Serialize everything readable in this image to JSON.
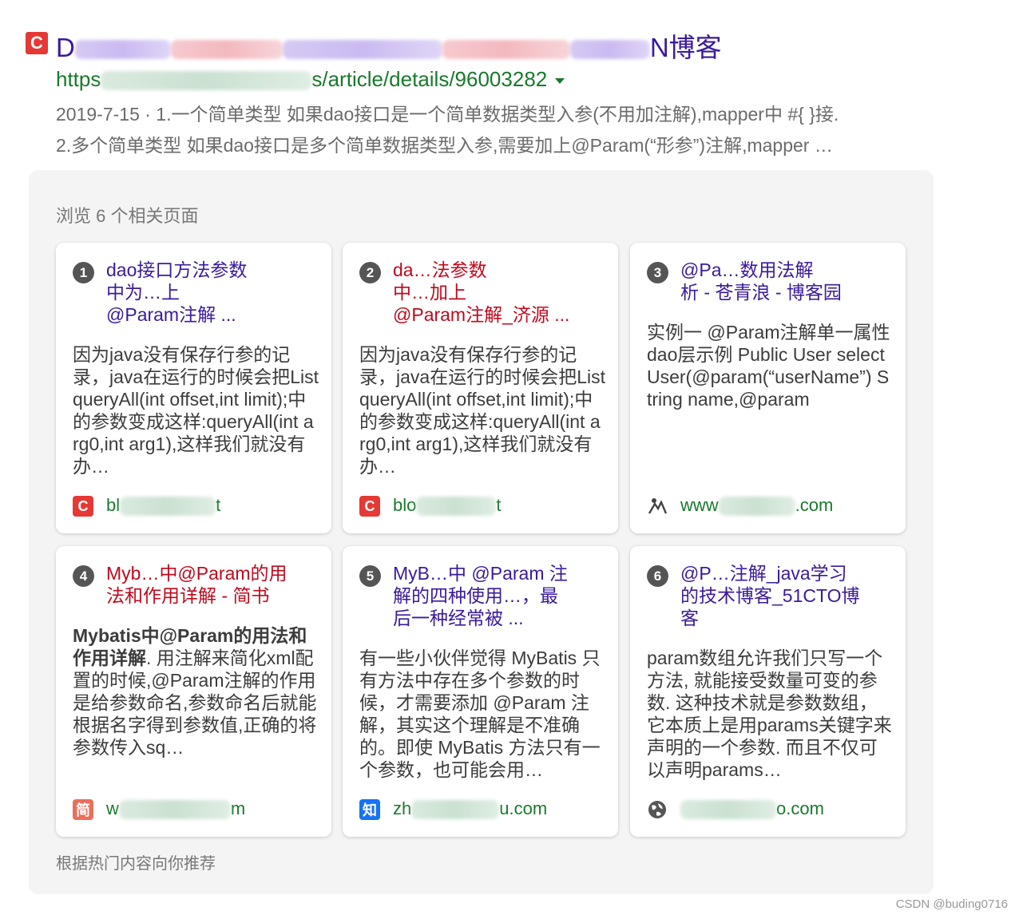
{
  "result": {
    "logo_letter": "C",
    "title_start": "D",
    "title_end": "N博客",
    "url_start": "https",
    "url_end": "s/article/details/96003282",
    "snippet_line1": "2019-7-15 · 1.一个简单类型 如果dao接口是一个简单数据类型入参(不用加注解),mapper中 #{ }接.",
    "snippet_line2": "2.多个简单类型 如果dao接口是多个简单数据类型入参,需要加上@Param(“形参”)注解,mapper …"
  },
  "panel": {
    "heading": "浏览 6 个相关页面",
    "footer": "根据热门内容向你推荐"
  },
  "cards": [
    {
      "number": "1",
      "title_line1": "dao接口方法参数",
      "title_line2": "中为…上",
      "title_line3": "@Param注解 ...",
      "desc": "因为java没有保存行参的记录，java在运行的时候会把List queryAll(int offset,int limit);中的参数变成这样:queryAll(int arg0,int arg1),这样我们就没有办…",
      "source_start": "bl",
      "source_end": "t",
      "icon": "csdn-icon",
      "icon_letter": "C",
      "icon_color": "#e53935"
    },
    {
      "number": "2",
      "title_line1": "da…法参数",
      "title_line2": "中…加上",
      "title_line3": "@Param注解_济源 ...",
      "desc": "因为java没有保存行参的记录，java在运行的时候会把List queryAll(int offset,int limit);中的参数变成这样:queryAll(int arg0,int arg1),这样我们就没有办…",
      "source_start": "blo",
      "source_end": "t",
      "icon": "csdn-icon",
      "icon_letter": "C",
      "icon_color": "#e53935"
    },
    {
      "number": "3",
      "title_line1": "@Pa…数用法解",
      "title_line2": "析 - 苍青浪 - 博客园",
      "desc": "实例一 @Param注解单一属性 dao层示例 Public User selectUser(@param(“userName”) String name,@param",
      "source_start": "www",
      "source_end": ".com",
      "icon": "cnblogs-icon",
      "icon_letter": "",
      "icon_color": "#444444"
    },
    {
      "number": "4",
      "title_line1": "Myb…中@Param的用",
      "title_line2": "法和作用详解 - 简书",
      "desc_bold": "Mybatis中@Param的用法和作用详解",
      "desc": ". 用注解来简化xml配置的时候,@Param注解的作用是给参数命名,参数命名后就能根据名字得到参数值,正确的将参数传入sq…",
      "source_start": "w",
      "source_end": "m",
      "icon": "jianshu-icon",
      "icon_letter": "简",
      "icon_color": "#ea6f5a"
    },
    {
      "number": "5",
      "title_line1": "MyB…中 @Param 注",
      "title_line2": "解的四种使用…，最",
      "title_line3": "后一种经常被 ...",
      "desc": "有一些小伙伴觉得 MyBatis 只有方法中存在多个参数的时候，才需要添加 @Param 注解，其实这个理解是不准确的。即使 MyBatis 方法只有一个参数，也可能会用…",
      "source_start": "zh",
      "source_end": "u.com",
      "icon": "zhihu-icon",
      "icon_letter": "知",
      "icon_color": "#1772f6"
    },
    {
      "number": "6",
      "title_line1": "@P…注解_java学习",
      "title_line2": "的技术博客_51CTO博",
      "title_line3": "客",
      "desc": "param数组允许我们只写一个方法, 就能接受数量可变的参数. 这种技术就是参数数组，它本质上是用params关键字来声明的一个参数. 而且不仅可以声明params…",
      "source_start": "",
      "source_end": "o.com",
      "icon": "globe-icon",
      "icon_letter": "",
      "icon_color": "#555555"
    }
  ],
  "watermark": "CSDN @buding0716"
}
